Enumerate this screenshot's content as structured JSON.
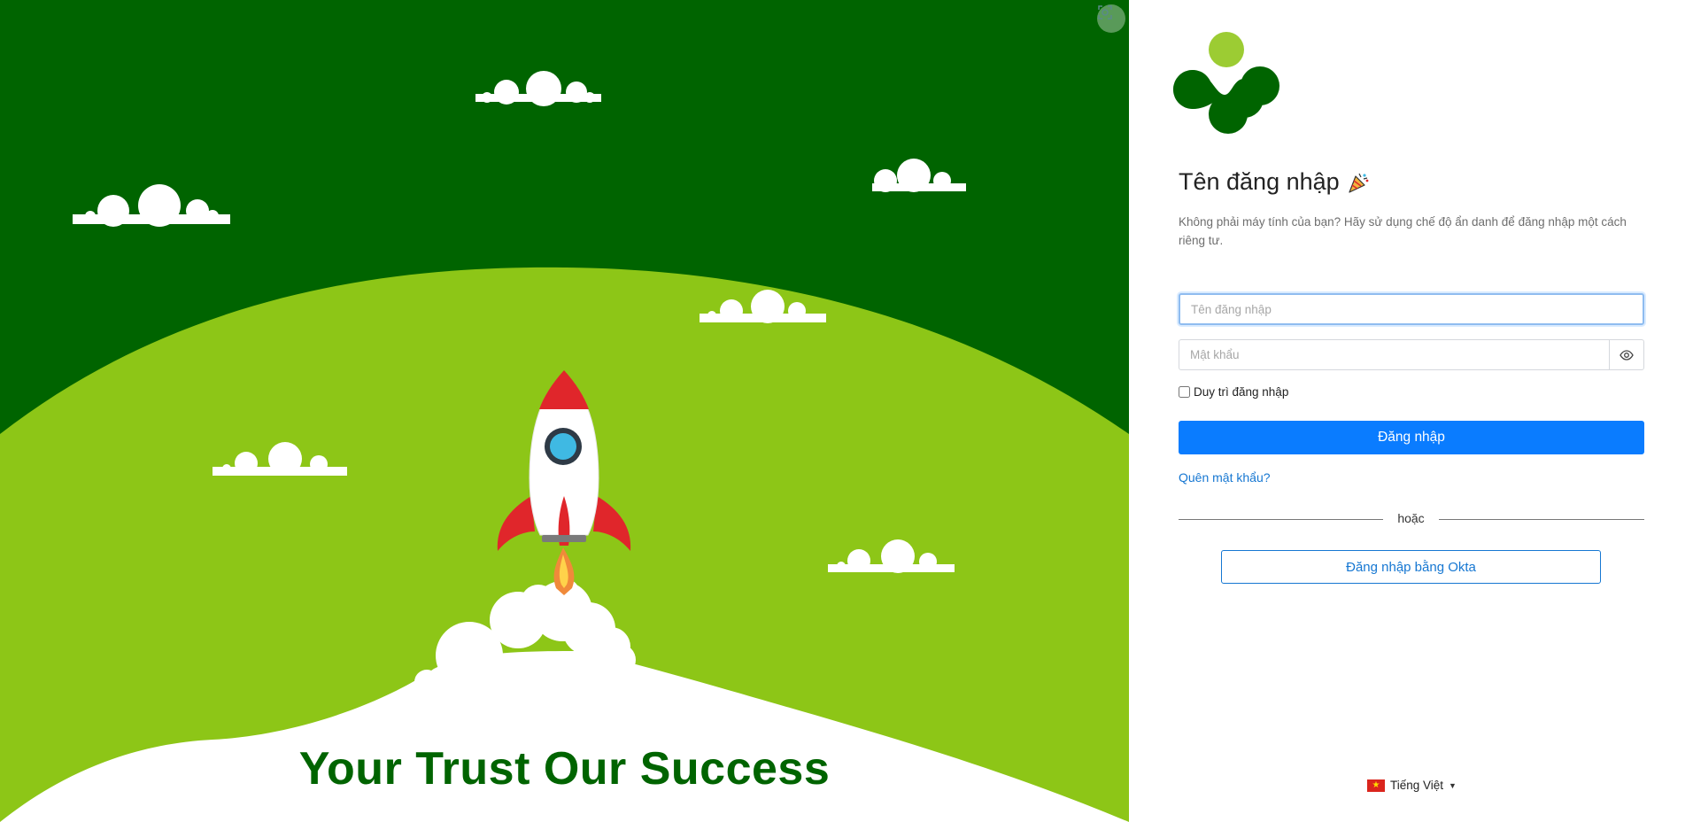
{
  "hero": {
    "tagline": "Your Trust Our Success",
    "scan_icon": "scan-icon"
  },
  "login": {
    "title": "Tên đăng nhập",
    "title_icon": "party-popper-icon",
    "subtitle": "Không phải máy tính của bạn? Hãy sử dụng chế độ ẩn danh để đăng nhập một cách riêng tư.",
    "username_placeholder": "Tên đăng nhập",
    "password_placeholder": "Mật khẩu",
    "password_toggle_icon": "eye-icon",
    "remember_label": "Duy trì đăng nhập",
    "submit_label": "Đăng nhập",
    "forgot_label": "Quên mật khẩu?",
    "or_label": "hoặc",
    "okta_label": "Đăng nhập bằng Okta"
  },
  "language": {
    "flag_icon": "vietnam-flag-icon",
    "label": "Tiếng Việt"
  },
  "colors": {
    "dark_green": "#006400",
    "light_green": "#8dc617",
    "primary_blue": "#0a7cff",
    "link_blue": "#1677d2",
    "logo_lime": "#9ccc33"
  }
}
